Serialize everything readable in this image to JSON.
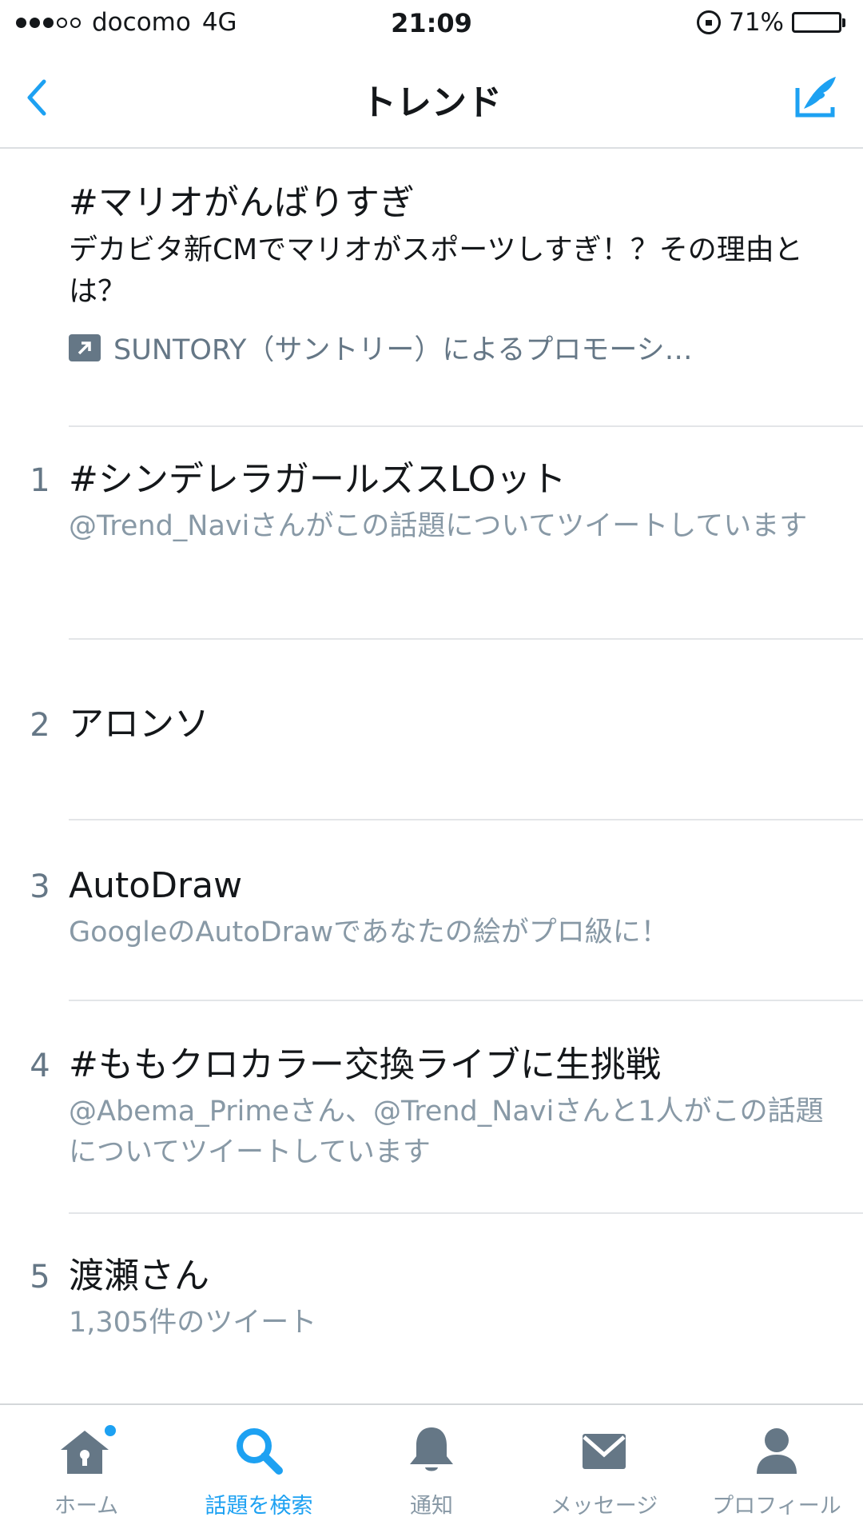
{
  "status_bar": {
    "carrier": "docomo",
    "network": "4G",
    "time": "21:09",
    "battery": "71%",
    "battery_level": 0.71
  },
  "nav": {
    "title": "トレンド",
    "back_icon": "chevron-left-icon",
    "compose_icon": "compose-tweet-icon",
    "accent_color": "#1da1f2"
  },
  "trends": {
    "promoted": {
      "title": "#マリオがんばりすぎ",
      "description": "デカビタ新CMでマリオがスポーツしすぎ！？その理由とは？",
      "promoted_by": "SUNTORY（サントリー）によるプロモーシ…"
    },
    "items": [
      {
        "rank": "1",
        "title": "#シンデレラガールズスLOット",
        "subtitle": "@Trend_Naviさんがこの話題についてツイートしています"
      },
      {
        "rank": "2",
        "title": "アロンソ",
        "subtitle": ""
      },
      {
        "rank": "3",
        "title": "AutoDraw",
        "subtitle": "GoogleのAutoDrawであなたの絵がプロ級に！"
      },
      {
        "rank": "4",
        "title": "#ももクロカラー交換ライブに生挑戦",
        "subtitle": "@Abema_Primeさん、@Trend_Naviさんと1人がこの話題についてツイートしています"
      },
      {
        "rank": "5",
        "title": "渡瀬さん",
        "subtitle": "1,305件のツイート"
      }
    ]
  },
  "tabs": [
    {
      "label": "ホーム",
      "icon": "home-icon"
    },
    {
      "label": "話題を検索",
      "icon": "search-icon",
      "active": true
    },
    {
      "label": "通知",
      "icon": "bell-icon"
    },
    {
      "label": "メッセージ",
      "icon": "envelope-icon"
    },
    {
      "label": "プロフィール",
      "icon": "profile-icon"
    }
  ]
}
